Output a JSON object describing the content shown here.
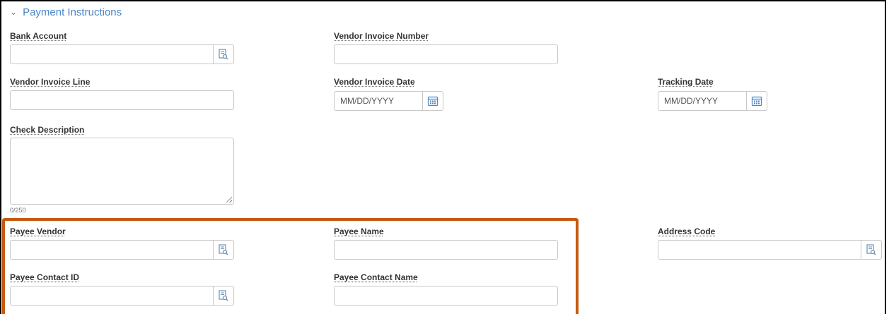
{
  "section": {
    "title": "Payment Instructions"
  },
  "fields": {
    "bank_account": {
      "label": "Bank Account",
      "value": ""
    },
    "vendor_invoice_number": {
      "label": "Vendor Invoice Number",
      "value": ""
    },
    "vendor_invoice_line": {
      "label": "Vendor Invoice Line",
      "value": ""
    },
    "vendor_invoice_date": {
      "label": "Vendor Invoice Date",
      "placeholder": "MM/DD/YYYY"
    },
    "tracking_date": {
      "label": "Tracking Date",
      "placeholder": "MM/DD/YYYY"
    },
    "check_description": {
      "label": "Check Description",
      "value": "",
      "counter": "0/250"
    },
    "payee_vendor": {
      "label": "Payee Vendor",
      "value": ""
    },
    "payee_name": {
      "label": "Payee Name",
      "value": ""
    },
    "address_code": {
      "label": "Address Code",
      "value": ""
    },
    "payee_contact_id": {
      "label": "Payee Contact ID",
      "value": ""
    },
    "payee_contact_name": {
      "label": "Payee Contact Name",
      "value": ""
    }
  },
  "colors": {
    "accent": "#4a86c5",
    "highlight": "#c55a11",
    "border": "#c8c8c8"
  },
  "icons": {
    "lookup": "lookup-icon",
    "calendar": "calendar-icon",
    "chevron": "chevron-down-icon"
  }
}
